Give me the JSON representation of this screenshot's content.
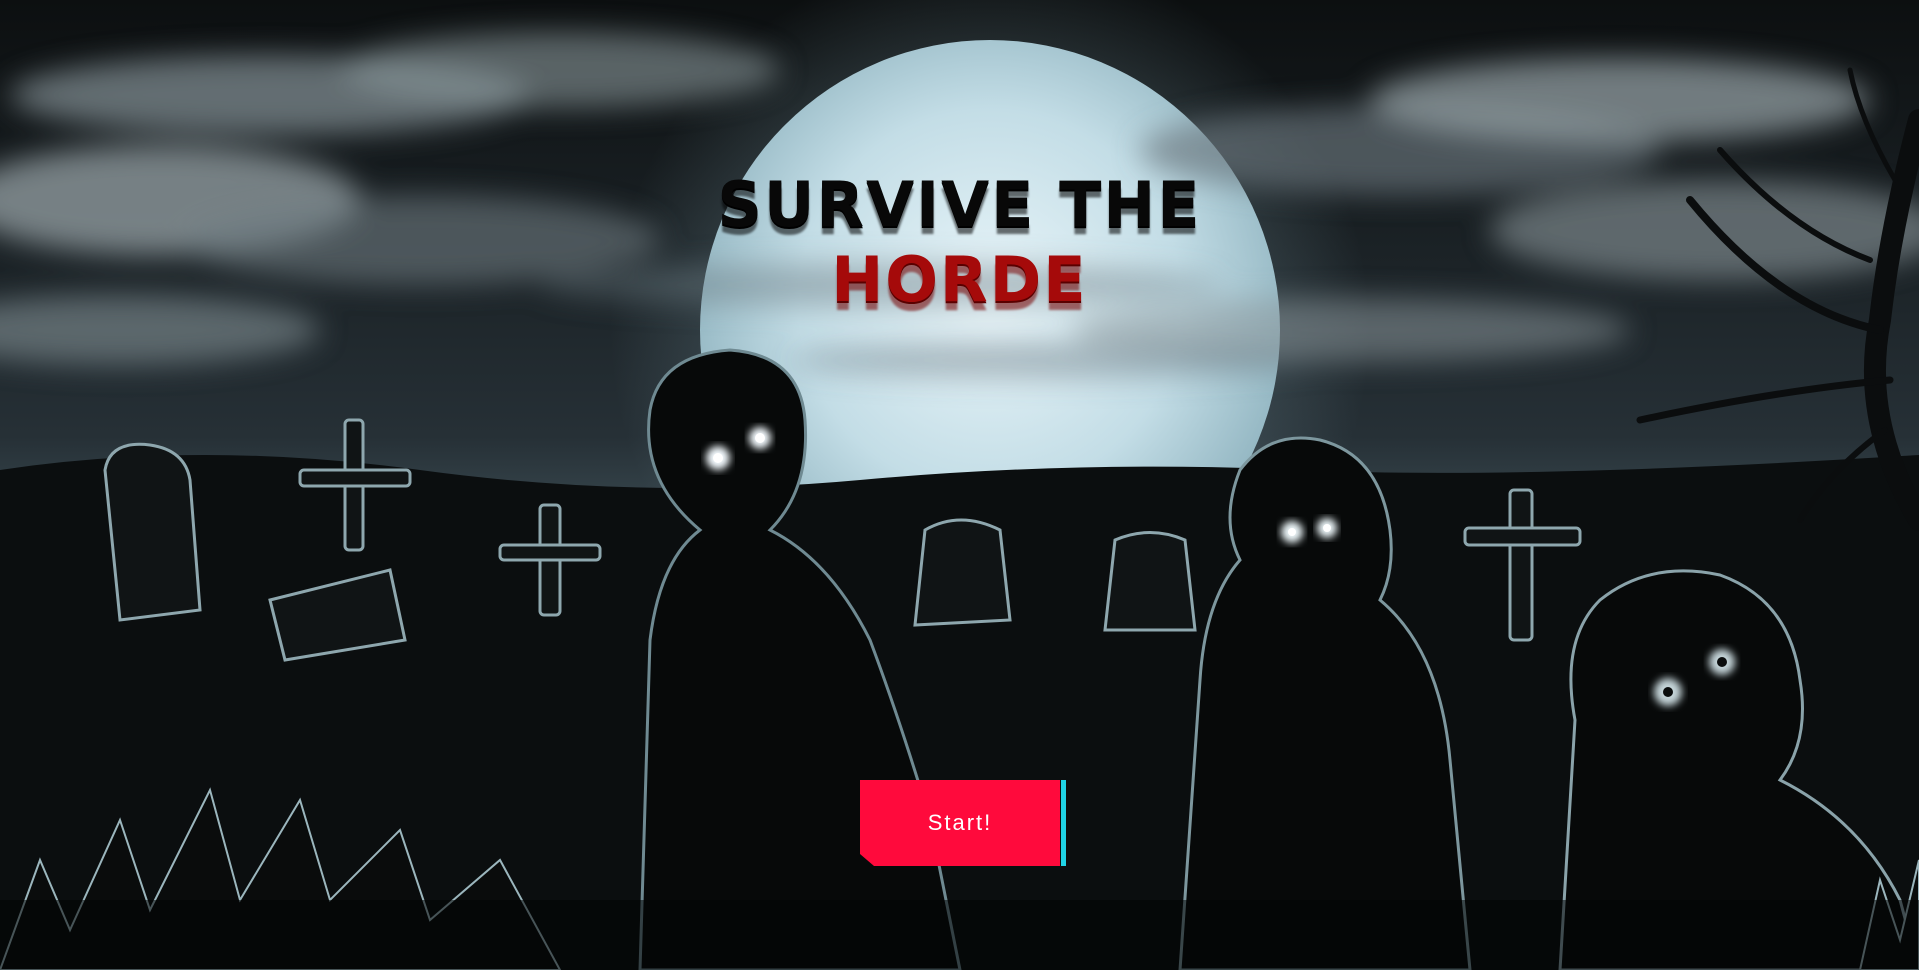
{
  "title": {
    "line1": "SURVIVE THE",
    "line2": "HORDE"
  },
  "start_button": {
    "label": "Start!"
  },
  "colors": {
    "title_dark": "#080808",
    "title_blood": "#a50a0a",
    "button": "#ff0a3c",
    "button_accent": "#1fd4e6",
    "moon": "#cfe6ee",
    "sky": "#1a1f22"
  }
}
